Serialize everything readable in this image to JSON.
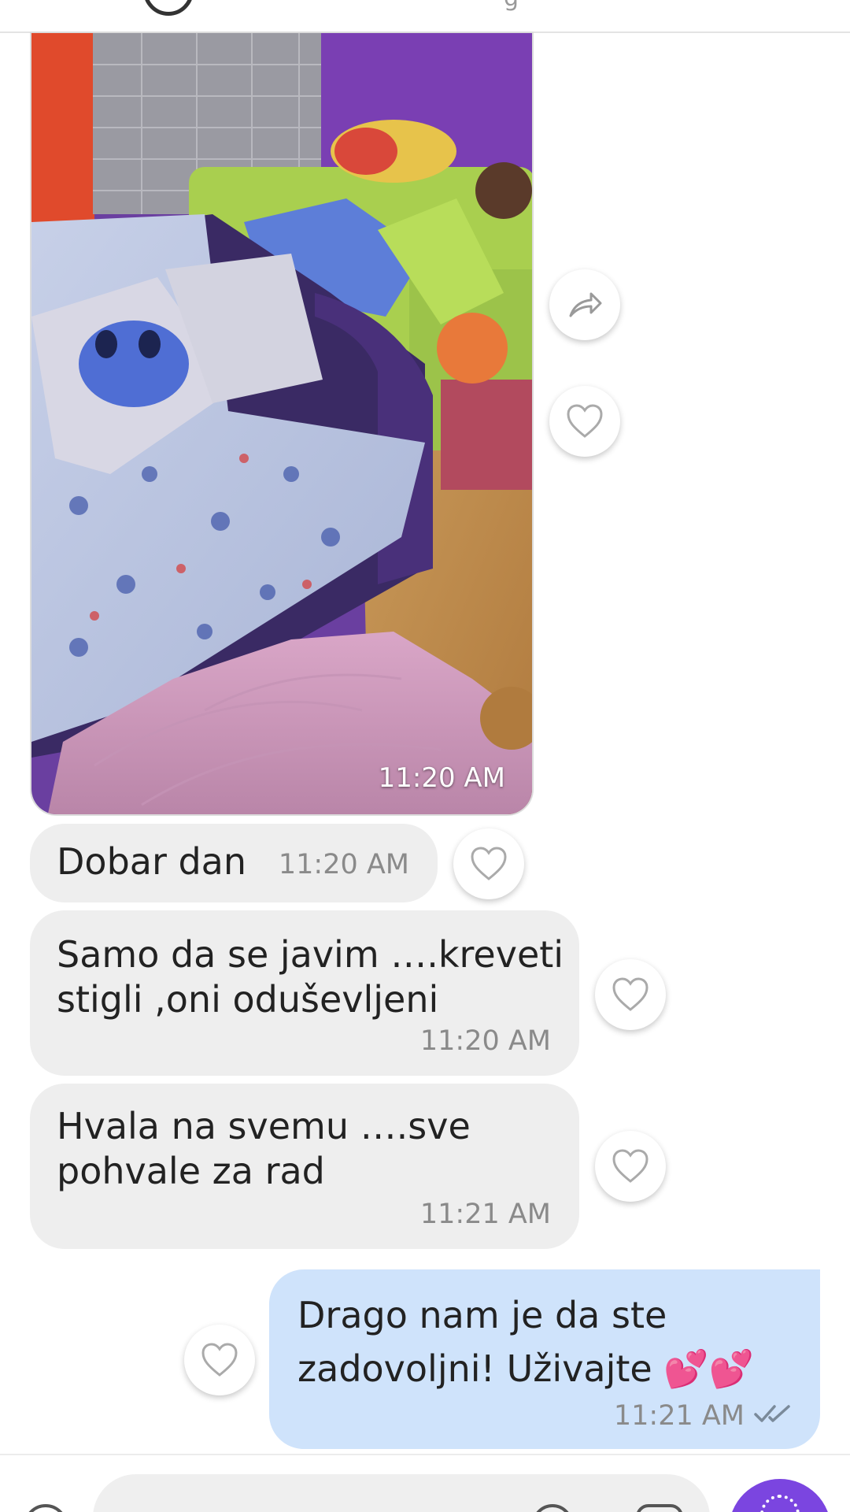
{
  "colors": {
    "incoming_bubble": "#eeeeee",
    "outgoing_bubble": "#cfe3fb",
    "accent": "#7b45e0",
    "timestamp": "#8a8a8a"
  },
  "header": {
    "avatar_icon": "avatar",
    "partial_title_glyph": "g"
  },
  "image_message": {
    "time": "11:20 AM",
    "description_icon": "photo-attachment",
    "actions": {
      "forward_icon": "forward-arrow-icon",
      "like_icon": "heart-icon"
    }
  },
  "messages": [
    {
      "direction": "in",
      "text": "Dobar dan",
      "time": "11:20 AM"
    },
    {
      "direction": "in",
      "text": "Samo da se javim ….kreveti\nstigli ,oni oduševljeni",
      "time": "11:20 AM"
    },
    {
      "direction": "in",
      "text": "Hvala na svemu ….sve\npohvale za rad",
      "time": "11:21 AM"
    },
    {
      "direction": "out",
      "text": "Drago nam je da ste\nzadovoljni! Uživajte 💕💕",
      "time": "11:21 AM",
      "status": "read"
    }
  ],
  "composer": {
    "record_icon": "record-icon",
    "emoji_icon": "emoji-icon",
    "sticker_icon": "sticker-icon",
    "attach_icon": "attach-icon"
  }
}
